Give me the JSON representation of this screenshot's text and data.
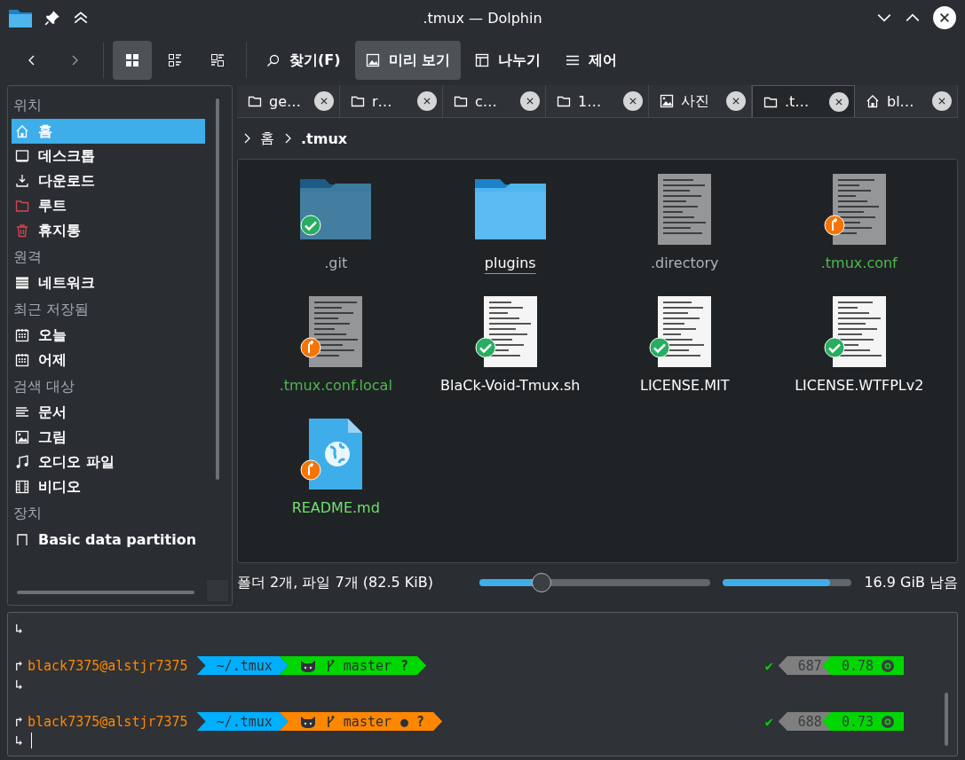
{
  "window": {
    "title": ".tmux — Dolphin"
  },
  "toolbar": {
    "views": [
      {
        "kind": "icons",
        "selected": true
      },
      {
        "kind": "details",
        "selected": false
      },
      {
        "kind": "compact",
        "selected": false
      }
    ],
    "actions": [
      {
        "kind": "search",
        "label": "찾기(F)",
        "selected": false
      },
      {
        "kind": "preview",
        "label": "미리 보기",
        "selected": true
      },
      {
        "kind": "split",
        "label": "나누기",
        "selected": false
      },
      {
        "kind": "menu",
        "label": "제어",
        "selected": false
      }
    ]
  },
  "tabs": [
    {
      "kind": "folder",
      "label": "ge…",
      "selected": false
    },
    {
      "kind": "folder",
      "label": "r…",
      "selected": false
    },
    {
      "kind": "folder",
      "label": "c…",
      "selected": false
    },
    {
      "kind": "folder",
      "label": "1…",
      "selected": false
    },
    {
      "kind": "image",
      "label": "사진",
      "selected": false
    },
    {
      "kind": "folder",
      "label": ".t…",
      "selected": true
    },
    {
      "kind": "home",
      "label": "bl…",
      "selected": false
    }
  ],
  "sidebar": {
    "sections": [
      {
        "title": "위치",
        "items": [
          {
            "kind": "home",
            "label": "홈",
            "selected": true
          },
          {
            "kind": "desktop",
            "label": "데스크톱",
            "selected": false
          },
          {
            "kind": "download",
            "label": "다운로드",
            "selected": false
          },
          {
            "kind": "root",
            "label": "루트",
            "selected": false
          },
          {
            "kind": "trash",
            "label": "휴지통",
            "selected": false
          }
        ]
      },
      {
        "title": "원격",
        "items": [
          {
            "kind": "network",
            "label": "네트워크",
            "selected": false
          }
        ]
      },
      {
        "title": "최근 저장됨",
        "items": [
          {
            "kind": "calendar",
            "label": "오늘",
            "selected": false
          },
          {
            "kind": "calendar",
            "label": "어제",
            "selected": false
          }
        ]
      },
      {
        "title": "검색 대상",
        "items": [
          {
            "kind": "document",
            "label": "문서",
            "selected": false
          },
          {
            "kind": "image",
            "label": "그림",
            "selected": false
          },
          {
            "kind": "audio",
            "label": "오디오 파일",
            "selected": false
          },
          {
            "kind": "video",
            "label": "비디오",
            "selected": false
          }
        ]
      },
      {
        "title": "장치",
        "items": [
          {
            "kind": "drive",
            "label": "Basic data partition",
            "selected": false
          }
        ]
      }
    ]
  },
  "breadcrumb": [
    "홈",
    ".tmux"
  ],
  "files": [
    {
      "name": ".git",
      "kind": "folder",
      "hidden": true,
      "synced": true,
      "modified": false,
      "color": "#b0b3b6",
      "hovered": false
    },
    {
      "name": "plugins",
      "kind": "folder",
      "hidden": false,
      "synced": false,
      "modified": false,
      "color": "#fcfcfc",
      "hovered": true
    },
    {
      "name": ".directory",
      "kind": "text",
      "hidden": true,
      "synced": false,
      "modified": false,
      "color": "#b0b3b6",
      "hovered": false
    },
    {
      "name": ".tmux.conf",
      "kind": "text",
      "hidden": true,
      "synced": false,
      "modified": true,
      "color": "#4fb84f",
      "hovered": false
    },
    {
      "name": ".tmux.conf.local",
      "kind": "text",
      "hidden": true,
      "synced": false,
      "modified": true,
      "color": "#4fb84f",
      "hovered": false
    },
    {
      "name": "BlaCk-Void-Tmux.sh",
      "kind": "text",
      "hidden": false,
      "synced": true,
      "modified": false,
      "color": "#fcfcfc",
      "hovered": false
    },
    {
      "name": "LICENSE.MIT",
      "kind": "text",
      "hidden": false,
      "synced": true,
      "modified": false,
      "color": "#fcfcfc",
      "hovered": false
    },
    {
      "name": "LICENSE.WTFPLv2",
      "kind": "text",
      "hidden": false,
      "synced": true,
      "modified": false,
      "color": "#fcfcfc",
      "hovered": false
    },
    {
      "name": "README.md",
      "kind": "web",
      "hidden": false,
      "synced": false,
      "modified": true,
      "color": "#6fe06f",
      "hovered": false
    }
  ],
  "status": {
    "summary": "폴더 2개, 파일 7개 (82.5 KiB)",
    "zoom": {
      "level": 0.27
    },
    "space": {
      "level": 0.83
    },
    "free": "16.9 GiB 남음"
  },
  "terminal": {
    "lines": [
      {
        "kind": "continuation",
        "arrow": "↳",
        "cursor": false
      },
      {
        "kind": "blank"
      },
      {
        "kind": "prompt",
        "arrow": "↱",
        "user": "black7375@alstjr7375",
        "dir": "~/.tmux",
        "color": "#00d700",
        "branch": "master",
        "flags": "?",
        "check": "✔",
        "count": "687",
        "load": "0.78"
      },
      {
        "kind": "continuation",
        "arrow": "↳",
        "cursor": false
      },
      {
        "kind": "blank"
      },
      {
        "kind": "prompt",
        "arrow": "↱",
        "user": "black7375@alstjr7375",
        "dir": "~/.tmux",
        "color": "#ff8700",
        "branch": "master",
        "flags": "● ?",
        "check": "✔",
        "count": "688",
        "load": "0.73"
      },
      {
        "kind": "continuation",
        "arrow": "↳",
        "cursor": true
      }
    ]
  }
}
